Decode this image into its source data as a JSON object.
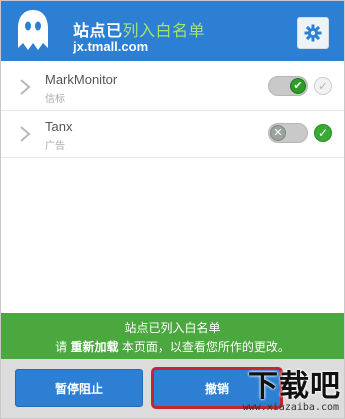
{
  "header": {
    "title_prefix": "站点已",
    "title_accent": "列入白名单",
    "domain": "jx.tmall.com",
    "settings_icon": "gear-icon",
    "logo_icon": "ghost-icon"
  },
  "trackers": [
    {
      "name": "MarkMonitor",
      "category": "信标",
      "toggle_state": "trusted",
      "checked": false
    },
    {
      "name": "Tanx",
      "category": "广告",
      "toggle_state": "blocked",
      "checked": true
    }
  ],
  "notice": {
    "line1": "站点已列入白名单",
    "line2_prefix": "请 ",
    "line2_bold": "重新加载",
    "line2_suffix": " 本页面，以查看您所作的更改。",
    "color": "#4aa83e"
  },
  "buttons": {
    "pause": "暂停阻止",
    "undo": "撤销"
  },
  "watermark": {
    "main": "下载吧",
    "sub": "www.xiazaiba.com"
  },
  "colors": {
    "brand": "#2c7fd2",
    "highlight": "#c1272d"
  }
}
